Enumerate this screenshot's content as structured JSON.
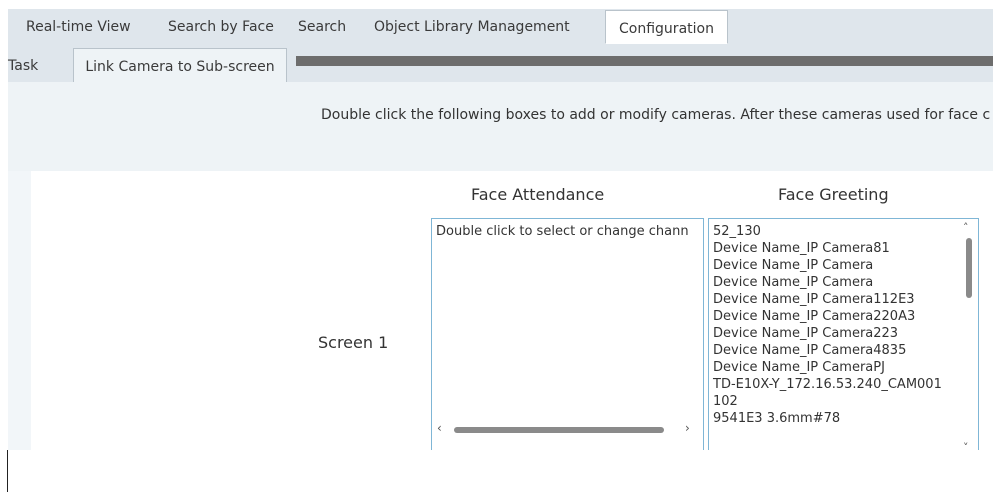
{
  "top_tabs": [
    {
      "label": "Real-time View",
      "active": false
    },
    {
      "label": "Search by Face",
      "active": false
    },
    {
      "label": "Search",
      "active": false
    },
    {
      "label": "Object Library Management",
      "active": false
    },
    {
      "label": "Configuration",
      "active": true
    }
  ],
  "sub_tabs": [
    {
      "label": "Task",
      "active": false
    },
    {
      "label": "Link Camera to Sub-screen",
      "active": true
    }
  ],
  "instruction": "Double click the following boxes to add or modify cameras. After these cameras used for face c",
  "columns": {
    "attendance": "Face Attendance",
    "greeting": "Face Greeting"
  },
  "screen_label": "Screen 1",
  "attendance_box": {
    "placeholder": "Double click to select or change chann"
  },
  "greeting_box": {
    "cameras": [
      "52_130",
      "Device Name_IP Camera81",
      "Device Name_IP Camera",
      "Device Name_IP Camera",
      "Device Name_IP Camera112E3",
      "Device Name_IP Camera220A3",
      "Device Name_IP Camera223",
      "Device Name_IP Camera4835",
      "Device Name_IP CameraPJ",
      "TD-E10X-Y_172.16.53.240_CAM001",
      "102",
      "9541E3 3.6mm#78"
    ]
  },
  "icons": {
    "scroll_up": "chevron-up-icon",
    "scroll_down": "chevron-down-icon",
    "scroll_left": "chevron-left-icon",
    "scroll_right": "chevron-right-icon"
  },
  "colors": {
    "tab_bar_bg": "#dfe6ec",
    "panel_bg": "#eef3f6",
    "box_border": "#7fb6d6",
    "redaction": "#6d6d6d"
  }
}
